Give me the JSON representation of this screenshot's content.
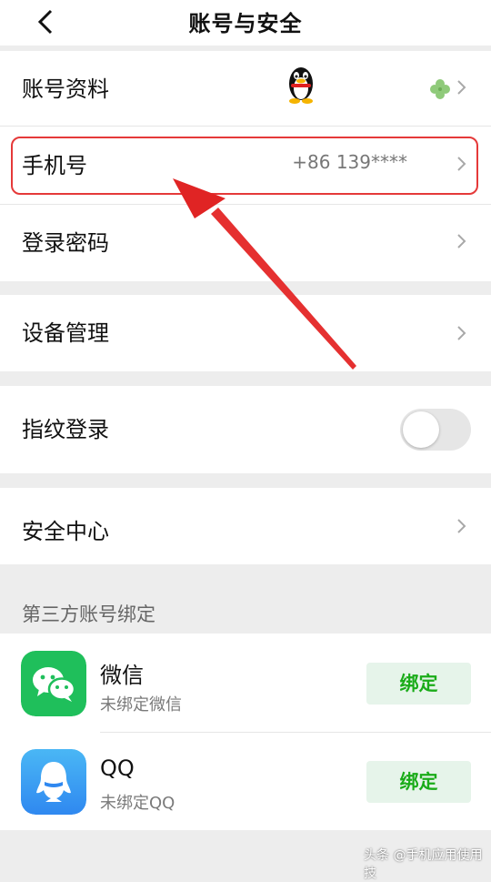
{
  "header": {
    "title": "账号与安全",
    "back_icon": "chevron-left-icon"
  },
  "account_rows": [
    {
      "label": "账号资料",
      "icons": [
        "qq-penguin-icon",
        "clover-icon"
      ]
    },
    {
      "label": "手机号",
      "value": "+86 139****"
    },
    {
      "label": "登录密码"
    }
  ],
  "device": {
    "label": "设备管理"
  },
  "fingerprint": {
    "label": "指纹登录",
    "enabled": false
  },
  "security_center": {
    "label": "安全中心"
  },
  "third_party": {
    "section_title": "第三方账号绑定",
    "items": [
      {
        "name": "微信",
        "status": "未绑定微信",
        "button": "绑定",
        "icon": "wechat-icon"
      },
      {
        "name": "QQ",
        "status": "未绑定QQ",
        "button": "绑定",
        "icon": "qq-icon"
      }
    ]
  },
  "watermark": "头条 @手机应用使用技",
  "colors": {
    "accent_green": "#1aac19",
    "highlight_red": "#e53939"
  }
}
